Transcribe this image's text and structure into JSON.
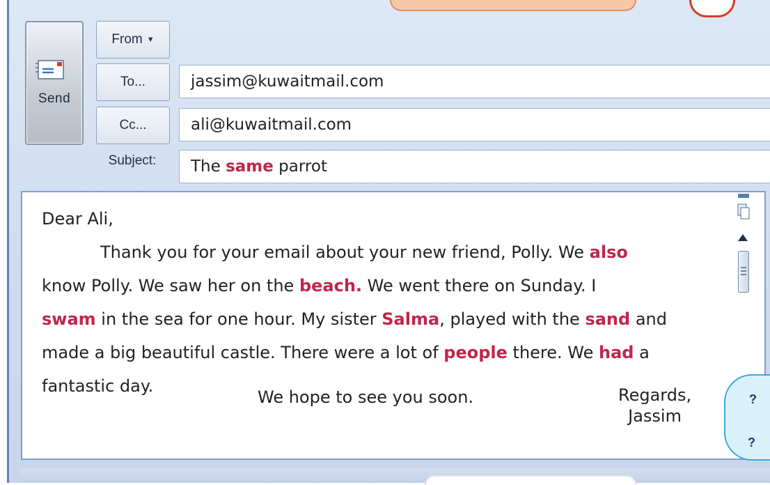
{
  "toolbar": {
    "send_label": "Send",
    "from_label": "From",
    "to_label": "To...",
    "cc_label": "Cc...",
    "subject_label": "Subject:"
  },
  "fields": {
    "to_value": "jassim@kuwaitmail.com",
    "cc_value": "ali@kuwaitmail.com",
    "subject_parts": [
      "The ",
      "same",
      " parrot"
    ]
  },
  "body": {
    "greeting": "Dear Ali,",
    "lines": [
      [
        "Thank you for your email about your new friend, Polly. We ",
        "also",
        ""
      ],
      [
        "know Polly. We saw her on the ",
        "beach.",
        " We went there on Sunday. I"
      ],
      [
        "",
        "swam",
        " in the sea for one hour. My sister "
      ],
      [
        "",
        "Salma",
        ", played with the "
      ],
      [
        "",
        "sand",
        " and"
      ],
      [
        "made a big beautiful castle. There were a lot of ",
        "people",
        " there. We "
      ],
      [
        "",
        "had",
        " a"
      ],
      [
        "fantastic day.",
        "",
        ""
      ]
    ],
    "closing_line": "We hope to see you soon.",
    "sign_off": "Regards,",
    "signature": "Jassim"
  },
  "cloud": {
    "q1": "?",
    "q2": "?"
  },
  "colors": {
    "highlight": "#c0264a",
    "frame": "#cfdcef",
    "border": "#7f9fc9"
  },
  "icons": [
    "send-mail-icon",
    "dropdown-caret-icon",
    "scroll-up-icon",
    "page-view-icon"
  ]
}
